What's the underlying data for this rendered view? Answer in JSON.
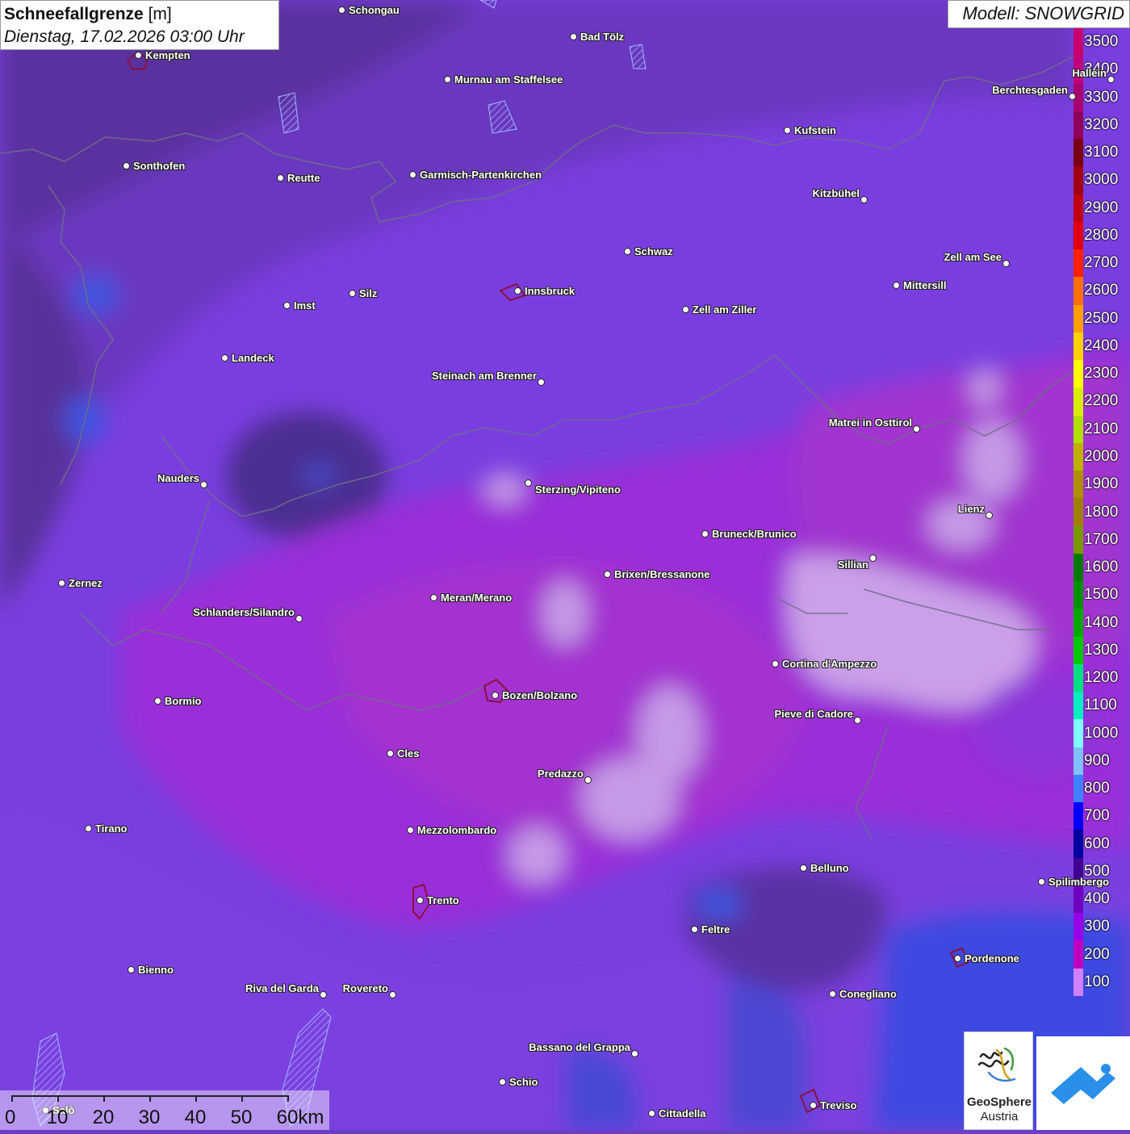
{
  "title": {
    "main": "Schneefallgrenze",
    "unit": "[m]",
    "datetime": "Dienstag, 17.02.2026 03:00 Uhr"
  },
  "model": "Modell: SNOWGRID",
  "legend": {
    "labels": [
      "3500",
      "3400",
      "3300",
      "3200",
      "3100",
      "3000",
      "2900",
      "2800",
      "2700",
      "2600",
      "2500",
      "2400",
      "2300",
      "2200",
      "2100",
      "2000",
      "1900",
      "1800",
      "1700",
      "1600",
      "1500",
      "1400",
      "1300",
      "1200",
      "1100",
      "1000",
      "900",
      "800",
      "700",
      "600",
      "500",
      "400",
      "300",
      "200",
      "100"
    ],
    "colors": [
      "#c8006e",
      "#c0007a",
      "#a8006c",
      "#900058",
      "#7a0010",
      "#a00010",
      "#c00010",
      "#e00010",
      "#ff2000",
      "#ff7000",
      "#ffa000",
      "#ffd000",
      "#ffff00",
      "#d8f000",
      "#b0e000",
      "#c0b000",
      "#b09000",
      "#a08000",
      "#7a9a00",
      "#007a00",
      "#009000",
      "#00a800",
      "#00c800",
      "#00e080",
      "#00f0c0",
      "#80ffff",
      "#80c0ff",
      "#4080ff",
      "#0000ff",
      "#0000a0",
      "#400090",
      "#7000c0",
      "#9800e8",
      "#c000c0",
      "#d080ff"
    ]
  },
  "cities": [
    {
      "name": "Schongau",
      "dx": -1,
      "dy": -1
    },
    {
      "name": "Kempten"
    },
    {
      "name": "Bad Tölz"
    },
    {
      "name": "Murnau am Staffelsee"
    },
    {
      "name": "Hallein"
    },
    {
      "name": "Berchtesgaden"
    },
    {
      "name": "Kufstein"
    },
    {
      "name": "Sonthofen"
    },
    {
      "name": "Reutte"
    },
    {
      "name": "Garmisch-Partenkirchen"
    },
    {
      "name": "Kitzbühel"
    },
    {
      "name": "Schwaz"
    },
    {
      "name": "Zell am See"
    },
    {
      "name": "Innsbruck"
    },
    {
      "name": "Mittersill"
    },
    {
      "name": "Silz"
    },
    {
      "name": "Imst"
    },
    {
      "name": "Zell am Ziller"
    },
    {
      "name": "Landeck"
    },
    {
      "name": "Steinach am Brenner"
    },
    {
      "name": "Matrei in Osttirol"
    },
    {
      "name": "Nauders"
    },
    {
      "name": "Sterzing/Vipiteno"
    },
    {
      "name": "Lienz"
    },
    {
      "name": "Bruneck/Brunico"
    },
    {
      "name": "Sillian"
    },
    {
      "name": "Zernez"
    },
    {
      "name": "Brixen/Bressanone"
    },
    {
      "name": "Meran/Merano"
    },
    {
      "name": "Schlanders/Silandro"
    },
    {
      "name": "Cortina d'Ampezzo"
    },
    {
      "name": "Bormio"
    },
    {
      "name": "Bozen/Bolzano"
    },
    {
      "name": "Pieve di Cadore"
    },
    {
      "name": "Cles"
    },
    {
      "name": "Predazzo"
    },
    {
      "name": "Tirano"
    },
    {
      "name": "Mezzolombardo"
    },
    {
      "name": "Belluno"
    },
    {
      "name": "Spilimbergo"
    },
    {
      "name": "Trento"
    },
    {
      "name": "Feltre"
    },
    {
      "name": "Pordenone"
    },
    {
      "name": "Bienno"
    },
    {
      "name": "Riva del Garda"
    },
    {
      "name": "Rovereto"
    },
    {
      "name": "Conegliano"
    },
    {
      "name": "Bassano del Grappa"
    },
    {
      "name": "Schio"
    },
    {
      "name": "Treviso"
    },
    {
      "name": "Cittadella"
    },
    {
      "name": "Salò"
    }
  ],
  "scale": {
    "labels": [
      "0",
      "10",
      "20",
      "30",
      "40",
      "50",
      "60km"
    ]
  },
  "logos": {
    "geosphere_line1": "GeoSphere",
    "geosphere_line2": "Austria"
  }
}
